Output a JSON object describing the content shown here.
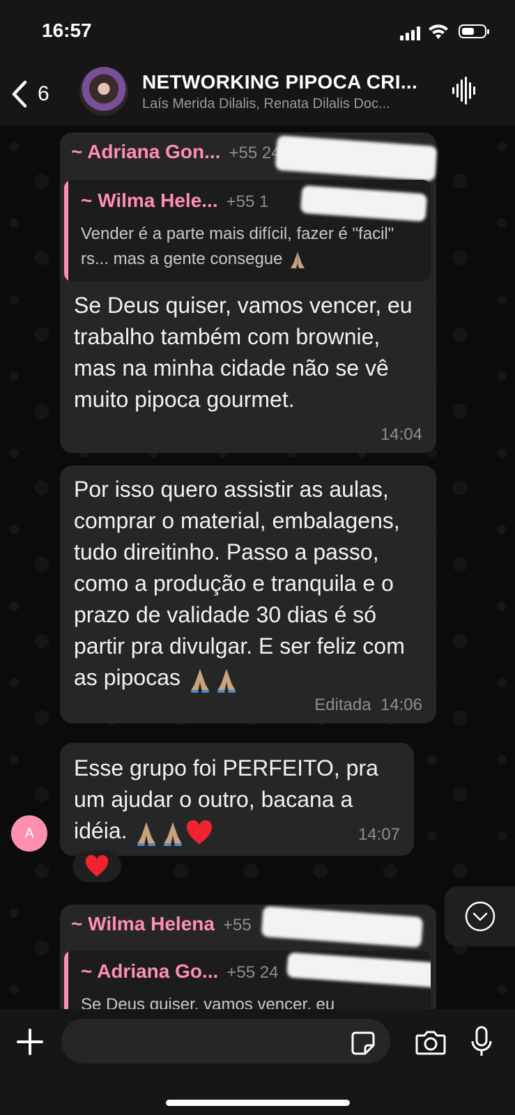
{
  "status_bar": {
    "time": "16:57"
  },
  "header": {
    "back_count": "6",
    "title": "NETWORKING PIPOCA CRI...",
    "subtitle": "Laís Merida Dilalis, Renata Dilalis Doc..."
  },
  "messages": [
    {
      "sender": "~ Adriana Gon...",
      "phone": "+55 24",
      "quote": {
        "sender": "~ Wilma Hele...",
        "phone": "+55 1",
        "text": "Vender é a parte mais difícil, fazer é \"facil\" rs... mas a gente consegue"
      },
      "text": "Se Deus quiser, vamos vencer, eu trabalho também com brownie, mas na minha cidade não se vê muito pipoca gourmet.",
      "time": "14:04"
    },
    {
      "text": "Por isso quero assistir as aulas, comprar o material, embalagens, tudo direitinho. Passo a passo, como a produção e tranquila e o prazo de validade 30 dias é só partir pra divulgar. E ser feliz com as pipocas",
      "edited_label": "Editada",
      "time": "14:06"
    },
    {
      "text": "Esse grupo foi PERFEITO, pra um ajudar o outro, bacana a idéia.",
      "time": "14:07",
      "avatar_letter": "A",
      "reaction": "heart"
    },
    {
      "sender": "~ Wilma Helena",
      "phone": "+55",
      "quote": {
        "sender": "~ Adriana Go...",
        "phone": "+55 24",
        "text": "Se Deus quiser, vamos vencer, eu"
      }
    }
  ],
  "composer": {
    "placeholder": ""
  },
  "colors": {
    "accent": "#ff8fb0",
    "bubble": "#262626",
    "background": "#0b0b0b"
  }
}
